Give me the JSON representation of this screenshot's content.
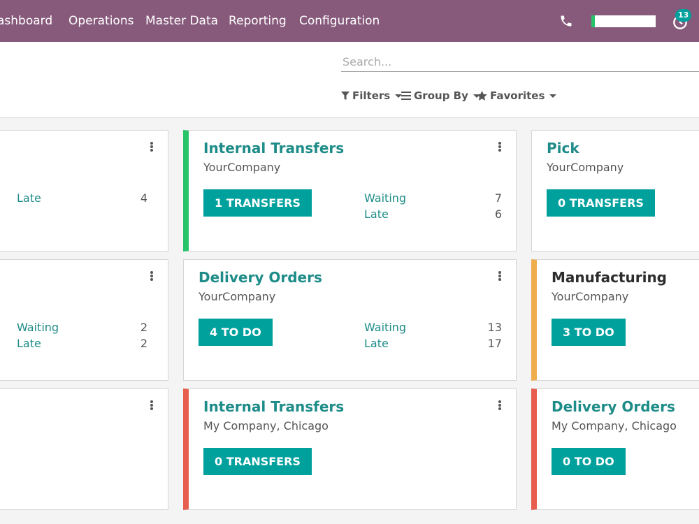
{
  "navbar": {
    "menu": [
      "ashboard",
      "Operations",
      "Master Data",
      "Reporting",
      "Configuration"
    ],
    "activity_count": "13",
    "color": "#875a7b"
  },
  "search": {
    "placeholder": "Search..."
  },
  "control_panel": {
    "filters_label": "Filters",
    "group_by_label": "Group By",
    "favorites_label": "Favorites"
  },
  "colors": {
    "accent": "#00a09d",
    "green": "#27c46a",
    "orange": "#f0ad4e",
    "red": "#e75e4e"
  },
  "cards": {
    "c1": {
      "stats": [
        {
          "label": "Late",
          "value": "4"
        }
      ]
    },
    "c2": {
      "title": "Internal Transfers",
      "company": "YourCompany",
      "button": "1 TRANSFERS",
      "stats": [
        {
          "label": "Waiting",
          "value": "7"
        },
        {
          "label": "Late",
          "value": "6"
        }
      ]
    },
    "c3": {
      "title": "Pick",
      "company": "YourCompany",
      "button": "0 TRANSFERS"
    },
    "c4": {
      "stats": [
        {
          "label": "Waiting",
          "value": "2"
        },
        {
          "label": "Late",
          "value": "2"
        }
      ]
    },
    "c5": {
      "title": "Delivery Orders",
      "company": "YourCompany",
      "button": "4 TO DO",
      "stats": [
        {
          "label": "Waiting",
          "value": "13"
        },
        {
          "label": "Late",
          "value": "17"
        }
      ]
    },
    "c6": {
      "title": "Manufacturing",
      "company": "YourCompany",
      "button": "3 TO DO"
    },
    "c8": {
      "title": "Internal Transfers",
      "company": "My Company, Chicago",
      "button": "0 TRANSFERS"
    },
    "c9": {
      "title": "Delivery Orders",
      "company": "My Company, Chicago",
      "button": "0 TO DO"
    }
  }
}
